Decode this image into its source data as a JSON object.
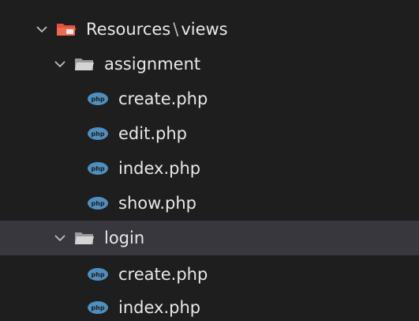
{
  "tree": {
    "root": {
      "name": "Resources",
      "separator": "\\",
      "subpath": "views"
    },
    "folders": [
      {
        "name": "assignment",
        "files": [
          "create.php",
          "edit.php",
          "index.php",
          "show.php"
        ]
      },
      {
        "name": "login",
        "files": [
          "create.php",
          "index.php"
        ]
      }
    ],
    "selected_folder": "login"
  },
  "icons": {
    "expand": "chevron-down-icon",
    "root_folder": "resources-folder-icon",
    "folder": "folder-icon",
    "file": "php-icon"
  },
  "colors": {
    "background": "#1e1e1e",
    "selected_row": "#37373d",
    "text": "#e8e8e8",
    "root_folder": "#e0543c",
    "folder": "#c8c8c8",
    "php_badge": "#4f8fc0"
  }
}
